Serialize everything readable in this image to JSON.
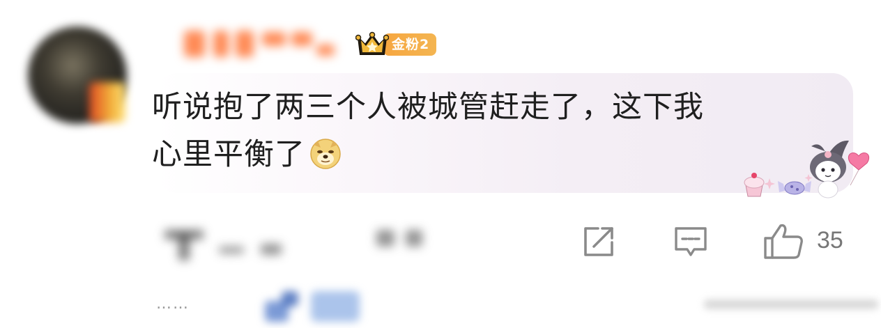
{
  "comment": {
    "badge_label": "金粉2",
    "text_line1": "听说抱了两三个人被城管赶走了，这下我",
    "text_line2": "心里平衡了"
  },
  "actions": {
    "share_icon": "share-icon",
    "reply_icon": "comment-icon",
    "like_icon": "thumbs-up-icon",
    "like_count": "35"
  },
  "replies": {
    "ellipsis": "……"
  },
  "colors": {
    "badge": "#f6a640",
    "bubble": "#f3edf5",
    "icon": "#8a8a8a"
  }
}
